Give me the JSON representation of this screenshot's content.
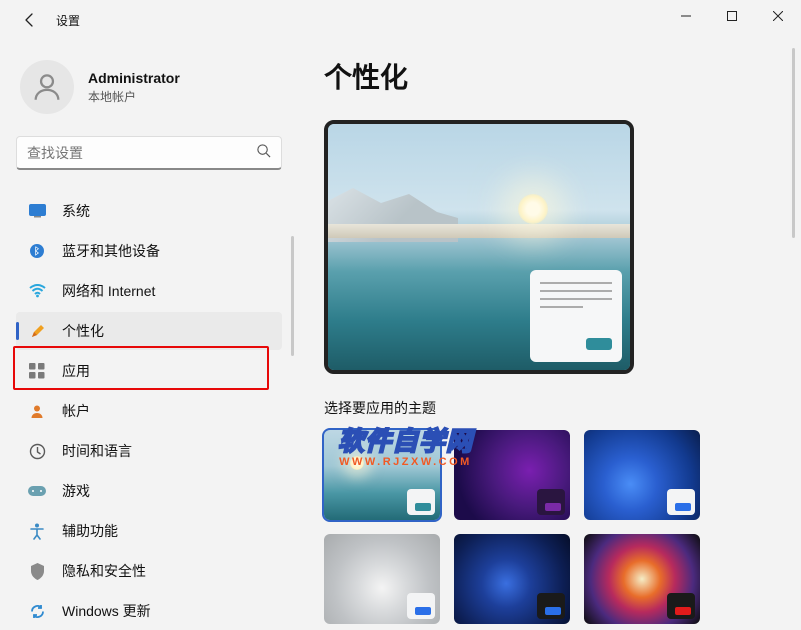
{
  "titlebar": {
    "title": "设置"
  },
  "user": {
    "name": "Administrator",
    "sub": "本地帐户"
  },
  "search": {
    "placeholder": "查找设置"
  },
  "nav": {
    "items": [
      {
        "label": "系统"
      },
      {
        "label": "蓝牙和其他设备"
      },
      {
        "label": "网络和 Internet"
      },
      {
        "label": "个性化"
      },
      {
        "label": "应用"
      },
      {
        "label": "帐户"
      },
      {
        "label": "时间和语言"
      },
      {
        "label": "游戏"
      },
      {
        "label": "辅助功能"
      },
      {
        "label": "隐私和安全性"
      },
      {
        "label": "Windows 更新"
      }
    ]
  },
  "main": {
    "title": "个性化",
    "section_label": "选择要应用的主题",
    "themes": [
      {
        "accent": "#2f8d9b",
        "selected": true
      },
      {
        "accent": "#7a2aa6",
        "selected": false
      },
      {
        "accent": "#2a6fe8",
        "selected": false
      },
      {
        "accent": "#2a6fe8",
        "selected": false
      },
      {
        "accent": "#2a6fe8",
        "selected": false
      },
      {
        "accent": "#e11b1b",
        "selected": false
      }
    ]
  },
  "watermark": {
    "main": "软件自学网",
    "sub": "WWW.RJZXW.COM"
  }
}
